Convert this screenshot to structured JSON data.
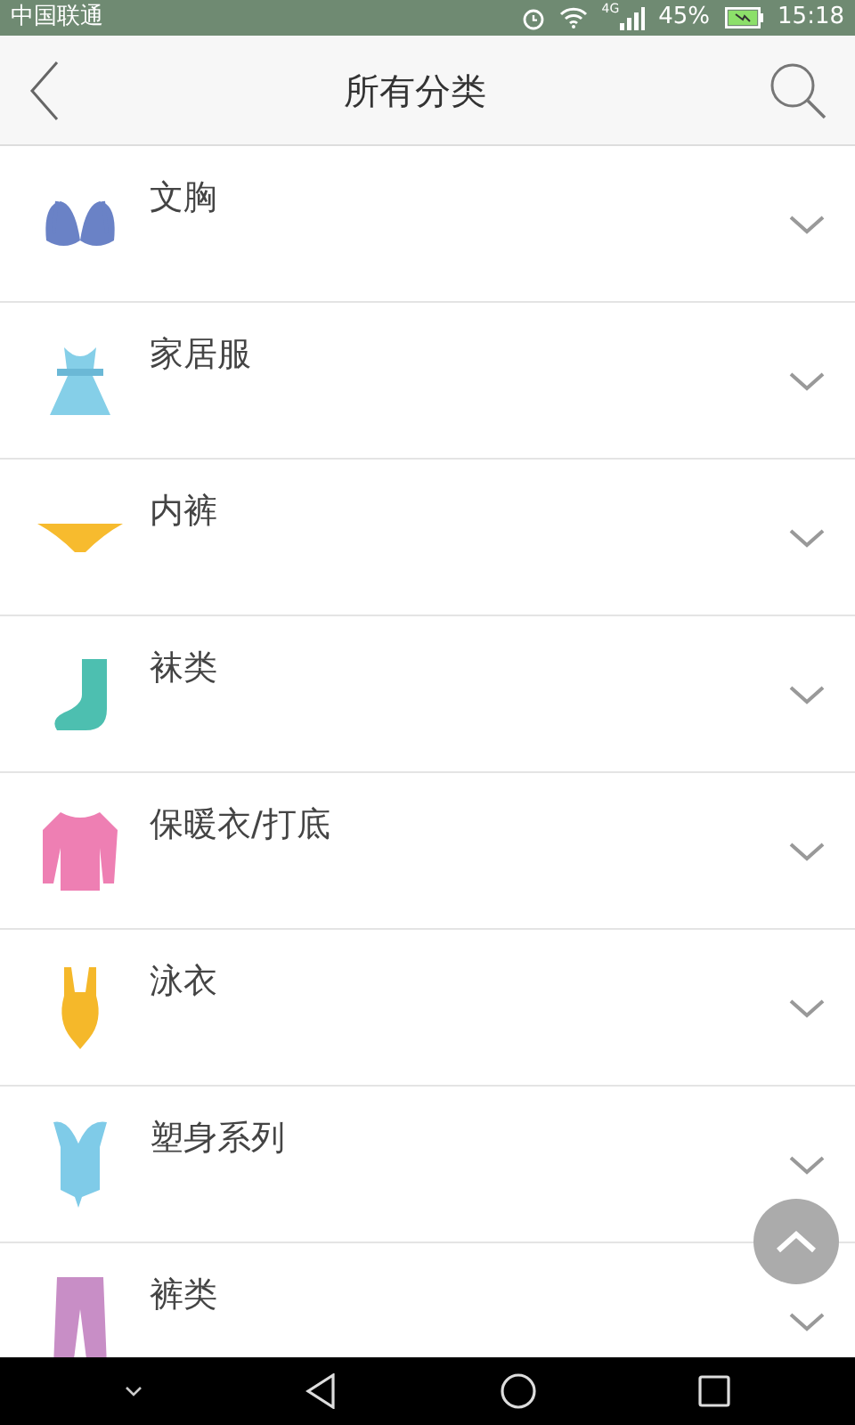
{
  "status_bar": {
    "carrier": "中国联通",
    "network": "4G",
    "battery": "45%",
    "time": "15:18"
  },
  "header": {
    "title": "所有分类"
  },
  "categories": [
    {
      "name": "文胸",
      "expanded": false
    },
    {
      "name": "家居服",
      "expanded": false
    },
    {
      "name": "内裤",
      "expanded": false
    },
    {
      "name": "袜类",
      "expanded": false
    },
    {
      "name": "保暖衣/打底",
      "expanded": false
    },
    {
      "name": "泳衣",
      "expanded": false
    },
    {
      "name": "塑身系列",
      "expanded": false
    },
    {
      "name": "裤类",
      "expanded": false
    }
  ]
}
